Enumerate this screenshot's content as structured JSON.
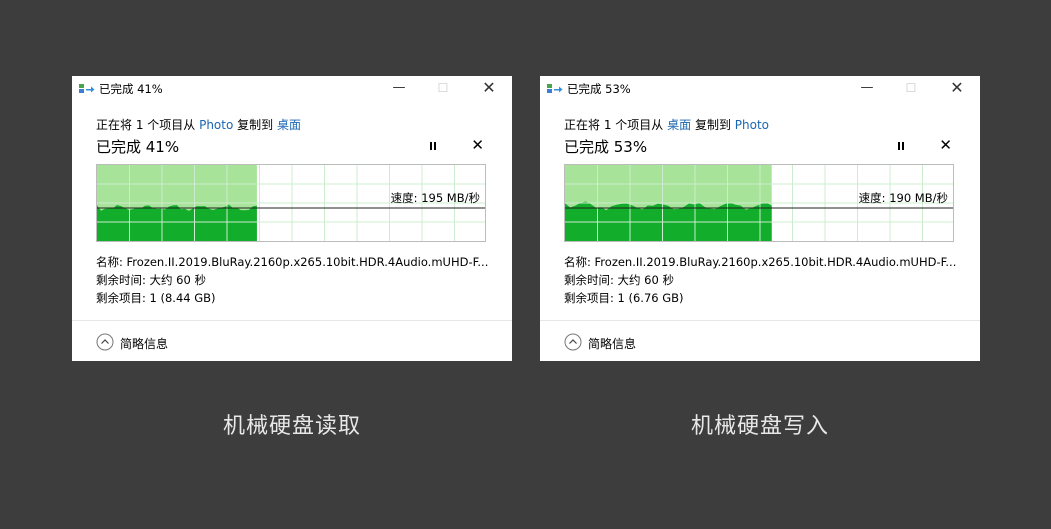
{
  "colors": {
    "background": "#3d3d3d",
    "progress_light": "#a8e39a",
    "progress_dark": "#12ad2b",
    "grid": "#cdeccf",
    "link": "#1a66b3"
  },
  "windows": [
    {
      "title": "已完成 41%",
      "copy_prefix": "正在将 1 个项目从",
      "source": "Photo",
      "copy_mid": "复制到",
      "dest": "桌面",
      "percent_text": "已完成 41%",
      "percent_value": 41,
      "speed_label": "速度: 195 MB/秒",
      "name_label": "名称:",
      "name_value": "Frozen.II.2019.BluRay.2160p.x265.10bit.HDR.4Audio.mUHD-F...",
      "time_label": "剩余时间:",
      "time_value": "大约 60 秒",
      "items_label": "剩余项目:",
      "items_value": "1 (8.44 GB)",
      "details_label": "简略信息",
      "icons": {
        "file": "file-copy-icon",
        "minimize": "minimize-icon",
        "maximize": "maximize-icon",
        "close": "close-icon",
        "pause": "pause-icon",
        "cancel": "cancel-icon",
        "details": "chevron-up-circle-icon"
      }
    },
    {
      "title": "已完成 53%",
      "copy_prefix": "正在将 1 个项目从",
      "source": "桌面",
      "copy_mid": "复制到",
      "dest": "Photo",
      "percent_text": "已完成 53%",
      "percent_value": 53,
      "speed_label": "速度: 190 MB/秒",
      "name_label": "名称:",
      "name_value": "Frozen.II.2019.BluRay.2160p.x265.10bit.HDR.4Audio.mUHD-F...",
      "time_label": "剩余时间:",
      "time_value": "大约 60 秒",
      "items_label": "剩余项目:",
      "items_value": "1 (6.76 GB)",
      "details_label": "简略信息",
      "icons": {
        "file": "file-copy-icon",
        "minimize": "minimize-icon",
        "maximize": "maximize-icon",
        "close": "close-icon",
        "pause": "pause-icon",
        "cancel": "cancel-icon",
        "details": "chevron-up-circle-icon"
      }
    }
  ],
  "captions": [
    "机械硬盘读取",
    "机械硬盘写入"
  ]
}
